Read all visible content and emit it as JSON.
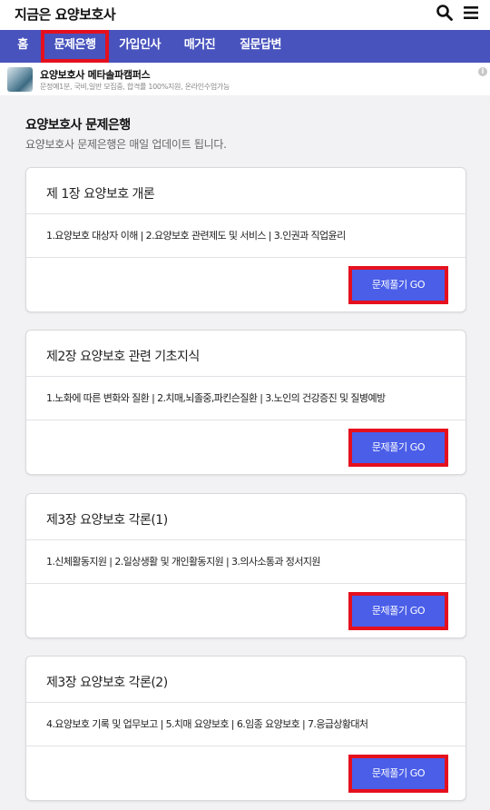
{
  "header": {
    "title": "지금은 요양보호사",
    "search_icon": "search-icon",
    "menu_icon": "hamburger-menu-icon"
  },
  "nav": {
    "items": [
      {
        "label": "홈"
      },
      {
        "label": "문제은행",
        "active": true
      },
      {
        "label": "가입인사"
      },
      {
        "label": "매거진"
      },
      {
        "label": "질문답변"
      }
    ]
  },
  "ad": {
    "title": "요양보호사 메타솔파캠퍼스",
    "description": "문정예1분, 국비,일반 모집중, 합격률 100%지원, 온라인수업가능",
    "info_icon": "i"
  },
  "page": {
    "title": "요양보호사 문제은행",
    "subtitle": "요양보호사 문제은행은 매일 업데이트 됩니다."
  },
  "cards": [
    {
      "title": "제 1장 요양보호 개론",
      "topics": "1.요양보호 대상자 이해  |  2.요양보호 관련제도 및 서비스 | 3.인권과 직업윤리",
      "button": "문제풀기 GO"
    },
    {
      "title": "제2장 요양보호 관련 기초지식",
      "topics": "1.노화에 따른 변화와 질환  |  2.치매,뇌졸중,파킨슨질환 | 3.노인의 건강증진 및 질병예방",
      "button": "문제풀기 GO"
    },
    {
      "title": "제3장 요양보호 각론(1)",
      "topics": "1.신체활동지원  |  2.일상생활 및 개인활동지원 | 3.의사소통과 정서지원",
      "button": "문제풀기 GO"
    },
    {
      "title": "제3장 요양보호 각론(2)",
      "topics": "4.요양보호 기록 및 업무보고  |  5.치매 요양보호 | 6.임종 요양보호  |  7.응급상황대처",
      "button": "문제풀기 GO"
    }
  ],
  "colors": {
    "nav_bg": "#4853bd",
    "button_bg": "#4a5ee8",
    "highlight": "#e5101e"
  }
}
